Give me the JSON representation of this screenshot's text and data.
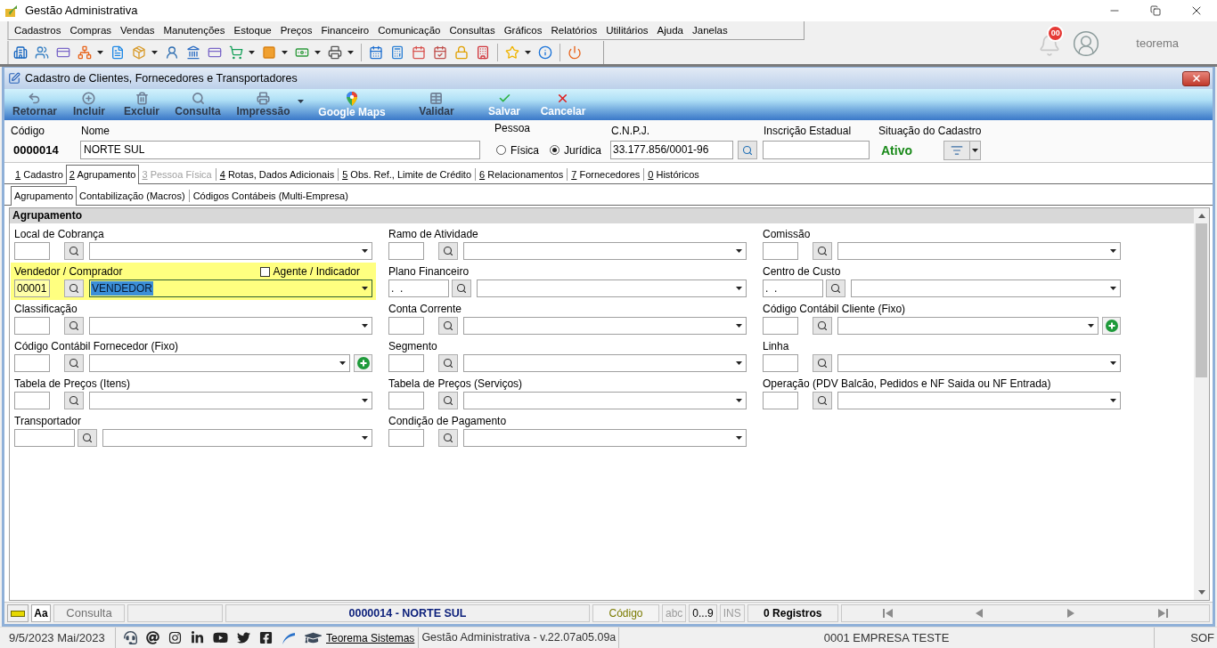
{
  "window": {
    "title": "Gestão Administrativa"
  },
  "menu": [
    "Cadastros",
    "Compras",
    "Vendas",
    "Manutenções",
    "Estoque",
    "Preços",
    "Financeiro",
    "Comunicação",
    "Consultas",
    "Gráficos",
    "Relatórios",
    "Utilitários",
    "Ajuda",
    "Janelas"
  ],
  "toolbar": [
    {
      "buttons": [
        {
          "dropdown": false
        },
        {
          "dropdown": false
        },
        {
          "dropdown": false
        },
        {
          "dropdown": true
        },
        {
          "dropdown": false
        },
        {
          "dropdown": true
        },
        {
          "dropdown": false
        },
        {
          "dropdown": false
        },
        {
          "dropdown": false
        },
        {
          "dropdown": true
        },
        {
          "dropdown": true
        },
        {
          "dropdown": true
        },
        {
          "dropdown": true
        }
      ]
    },
    {
      "buttons": [
        {
          "dropdown": false
        },
        {
          "dropdown": false
        },
        {
          "dropdown": false
        },
        {
          "dropdown": false
        },
        {
          "dropdown": false
        },
        {
          "dropdown": false
        }
      ]
    },
    {
      "buttons": [
        {
          "dropdown": true
        },
        {
          "dropdown": false
        }
      ]
    },
    {
      "buttons": [
        {
          "dropdown": false
        }
      ]
    }
  ],
  "notifications": {
    "badge": "00"
  },
  "user": {
    "name": "teorema"
  },
  "form": {
    "title": "Cadastro de Clientes, Fornecedores e Transportadores",
    "actions": [
      {
        "label": "Retornar",
        "disabled": true,
        "dropdown": false
      },
      {
        "label": "Incluir",
        "disabled": true,
        "dropdown": false
      },
      {
        "label": "Excluir",
        "disabled": true,
        "dropdown": false
      },
      {
        "label": "Consulta",
        "disabled": true,
        "dropdown": false
      },
      {
        "label": "Impressão",
        "disabled": true,
        "dropdown": true
      },
      {
        "label": "Google Maps",
        "disabled": false,
        "dropdown": false
      },
      {
        "label": "Validar",
        "disabled": true,
        "dropdown": false
      },
      {
        "label": "Salvar",
        "disabled": false,
        "dropdown": false
      },
      {
        "label": "Cancelar",
        "disabled": false,
        "dropdown": false
      }
    ],
    "header": {
      "code": {
        "label": "Código",
        "value": "0000014"
      },
      "name": {
        "label": "Nome",
        "value": "NORTE SUL"
      },
      "person_type": {
        "label": "Pessoa",
        "options": [
          {
            "label": "Física",
            "selected": false
          },
          {
            "label": "Jurídica",
            "selected": true
          }
        ]
      },
      "cnpj": {
        "label": "C.N.P.J.",
        "value": "33.177.856/0001-96"
      },
      "state_registration": {
        "label": "Inscrição Estadual"
      },
      "status": {
        "label": "Situação do Cadastro",
        "value": "Ativo"
      }
    },
    "tabs": [
      {
        "label": "1 Cadastro",
        "selected": false,
        "disabled": false
      },
      {
        "label": "2 Agrupamento",
        "selected": true,
        "disabled": false
      },
      {
        "label": "3 Pessoa Física",
        "selected": false,
        "disabled": true
      },
      {
        "label": "4 Rotas, Dados Adicionais",
        "selected": false,
        "disabled": false
      },
      {
        "label": "5 Obs. Ref., Limite de Crédito",
        "selected": false,
        "disabled": false
      },
      {
        "label": "6 Relacionamentos",
        "selected": false,
        "disabled": false
      },
      {
        "label": "7 Fornecedores",
        "selected": false,
        "disabled": false
      },
      {
        "label": "0 Históricos",
        "selected": false,
        "disabled": false
      }
    ],
    "subtabs": [
      {
        "label": "Agrupamento",
        "selected": true
      },
      {
        "label": "Contabilização (Macros)",
        "selected": false
      },
      {
        "label": "Códigos Contábeis (Multi-Empresa)",
        "selected": false
      }
    ],
    "section": {
      "title": "Agrupamento",
      "columns": [
        {
          "fields": [
            {
              "label": "Local de Cobrança",
              "focused": false,
              "add_button": false
            },
            {
              "label": "Vendedor / Comprador",
              "code": "00001",
              "value": "VENDEDOR",
              "focused": true,
              "add_button": false,
              "checkbox": {
                "label": "Agente / Indicador",
                "checked": false
              }
            },
            {
              "label": "Classificação",
              "focused": false,
              "add_button": false
            },
            {
              "label": "Código Contábil Fornecedor (Fixo)",
              "focused": false,
              "add_button": true
            },
            {
              "label": "Tabela de Preços (Itens)",
              "focused": false,
              "add_button": false
            },
            {
              "label": "Transportador",
              "focused": false,
              "add_button": false
            }
          ]
        },
        {
          "fields": [
            {
              "label": "Ramo de Atividade",
              "focused": false,
              "add_button": false
            },
            {
              "label": "Plano Financeiro",
              "code": ".  .",
              "focused": false,
              "add_button": false
            },
            {
              "label": "Conta Corrente",
              "focused": false,
              "add_button": false
            },
            {
              "label": "Segmento",
              "focused": false,
              "add_button": false
            },
            {
              "label": "Tabela de Preços (Serviços)",
              "focused": false,
              "add_button": false
            },
            {
              "label": "Condição de Pagamento",
              "focused": false,
              "add_button": false
            }
          ]
        },
        {
          "fields": [
            {
              "label": "Comissão",
              "focused": false,
              "add_button": false
            },
            {
              "label": "Centro de Custo",
              "code": ".  .",
              "focused": false,
              "add_button": false
            },
            {
              "label": "Código Contábil Cliente (Fixo)",
              "focused": false,
              "add_button": true
            },
            {
              "label": "Linha",
              "focused": false,
              "add_button": false
            },
            {
              "label": "Operação (PDV Balcão, Pedidos e NF Saida ou NF Entrada)",
              "focused": false,
              "add_button": false
            }
          ]
        }
      ]
    },
    "record_bar": {
      "font_button": "Aa",
      "mode": "Consulta",
      "record": "0000014 - NORTE SUL",
      "sort_field": "Código",
      "indicators": [
        {
          "label": "abc",
          "on": false
        },
        {
          "label": "0...9",
          "on": true
        },
        {
          "label": "INS",
          "on": false
        }
      ],
      "count": "0 Registros"
    }
  },
  "status_bar": {
    "date": "9/5/2023 Mai/2023",
    "link": "Teorema Sistemas",
    "version": "Gestão Administrativa - v.22.07a05.09a",
    "company": "0001 EMPRESA TESTE",
    "extra": "SOF"
  }
}
